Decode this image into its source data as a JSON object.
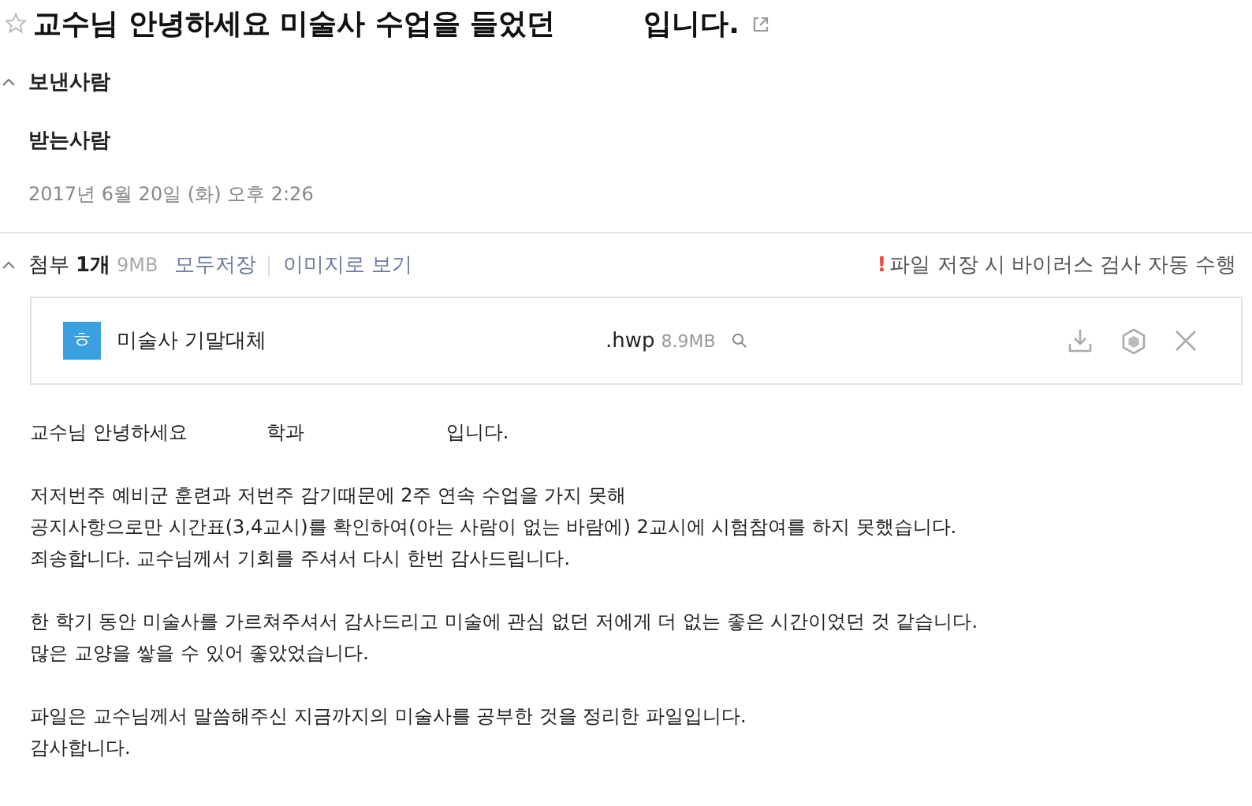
{
  "subject": {
    "parts": [
      "교수님 안녕하세요 미술사 수업을 들었던",
      "입니다."
    ],
    "starred": false
  },
  "header": {
    "expanded": true,
    "sender_label": "보낸사람",
    "recipient_label": "받는사람",
    "date": "2017년 6월 20일 (화) 오후 2:26"
  },
  "attachments": {
    "expanded": true,
    "label": "첨부",
    "count": "1개",
    "size": "9MB",
    "save_all": "모두저장",
    "view_as_image": "이미지로 보기",
    "notice_mark": "!",
    "notice": "파일 저장 시 바이러스 검사 자동 수행",
    "files": [
      {
        "type_glyph": "ㅎ",
        "name": "미술사 기말대체",
        "ext": ".hwp",
        "size": "8.9MB"
      }
    ]
  },
  "body": [
    [
      [
        "교수님 안녕하세요",
        "학과",
        "입니다."
      ]
    ],
    [
      [
        "저저번주 예비군 훈련과 저번주 감기때문에 2주 연속 수업을 가지 못해"
      ],
      [
        "공지사항으로만 시간표(3,4교시)를 확인하여(아는 사람이 없는 바람에) 2교시에 시험참여를 하지 못했습니다."
      ],
      [
        "죄송합니다. 교수님께서 기회를 주셔서 다시 한번 감사드립니다."
      ]
    ],
    [
      [
        "한 학기 동안 미술사를 가르쳐주셔서 감사드리고 미술에 관심 없던 저에게 더 없는 좋은 시간이었던 것 같습니다."
      ],
      [
        "많은 교양을 쌓을 수 있어 좋았었습니다."
      ]
    ],
    [
      [
        "파일은 교수님께서 말씀해주신 지금까지의 미술사를 공부한 것을 정리한 파일입니다."
      ],
      [
        "감사합니다."
      ]
    ]
  ]
}
